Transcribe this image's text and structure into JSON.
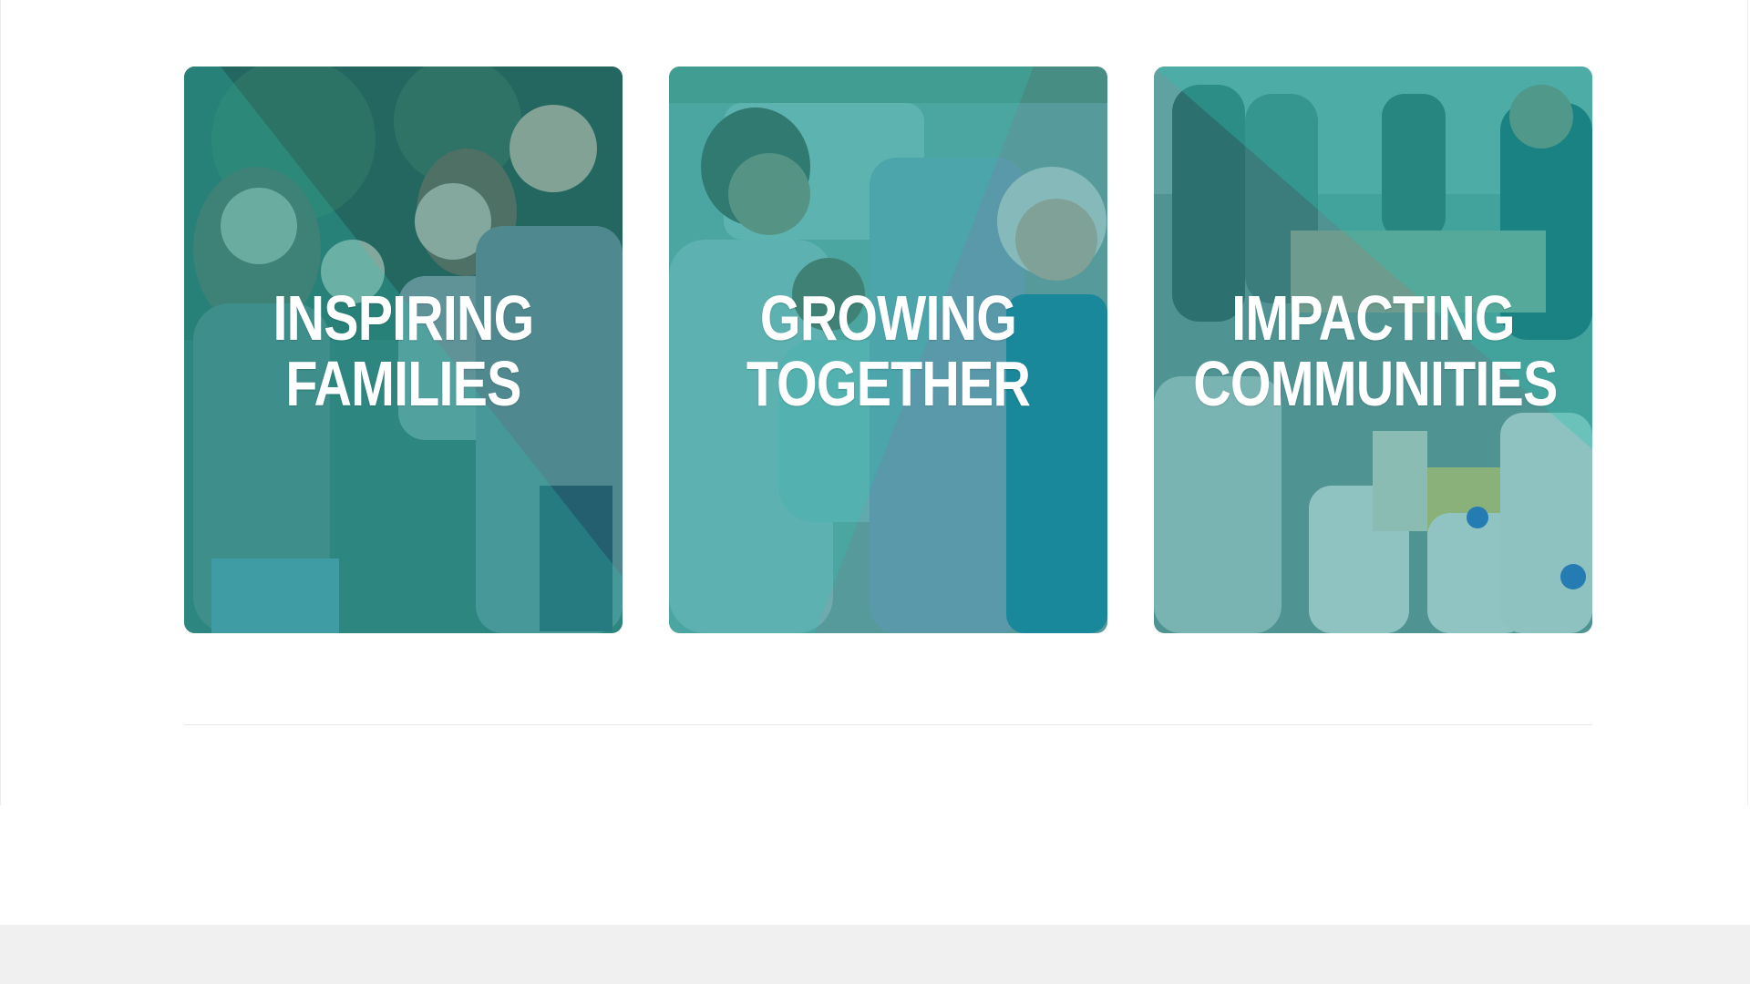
{
  "cards": [
    {
      "line1": "INSPIRING",
      "line2": "FAMILIES",
      "alt": "Family smiling together"
    },
    {
      "line1": "GROWING",
      "line2": "TOGETHER",
      "alt": "Mother with child and elderly woman"
    },
    {
      "line1": "IMPACTING",
      "line2": "COMMUNITIES",
      "alt": "Volunteers at food distribution"
    }
  ],
  "colors": {
    "overlay": "#198c8c",
    "diagonal": "#2fc4b2",
    "title": "#ffffff",
    "divider": "#e6e6e6",
    "footer": "#f0f0f0"
  }
}
